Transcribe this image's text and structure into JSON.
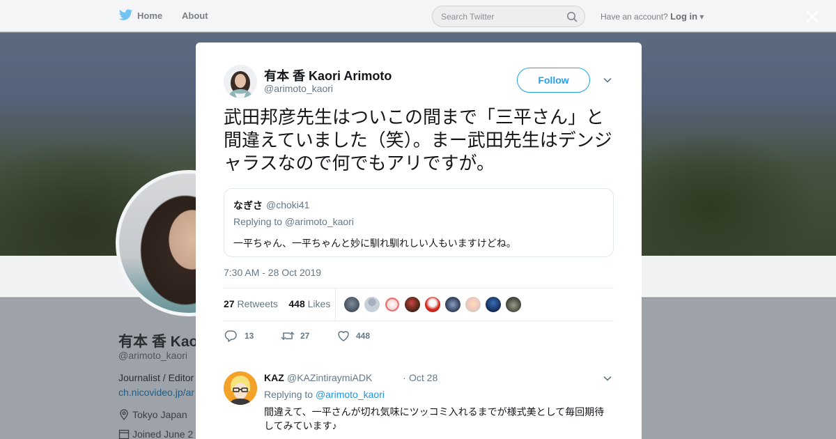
{
  "nav": {
    "home": "Home",
    "about": "About",
    "search_placeholder": "Search Twitter",
    "have_account": "Have an account?",
    "login": "Log in"
  },
  "profile": {
    "name": "有本 香 Kao",
    "handle": "@arimoto_kaori",
    "bio": "Journalist / Editor",
    "link": "ch.nicovideo.jp/ar",
    "location": "Tokyo Japan",
    "joined": "Joined June 2"
  },
  "tweet": {
    "author_name": "有本 香 Kaori Arimoto",
    "author_handle": "@arimoto_kaori",
    "follow_label": "Follow",
    "text": "武田邦彦先生はついこの間まで「三平さん」と間違えていました（笑）。まー武田先生はデンジャラスなので何でもアリですが。",
    "timestamp": "7:30 AM - 28 Oct 2019",
    "retweets_count": "27",
    "retweets_label": "Retweets",
    "likes_count": "448",
    "likes_label": "Likes",
    "actions": {
      "replies": "13",
      "retweets": "27",
      "likes": "448"
    }
  },
  "quote": {
    "name": "なぎさ",
    "handle": "@choki41",
    "replying_to": "Replying to @arimoto_kaori",
    "text": "一平ちゃん、一平ちゃんと妙に馴れ馴れしい人もいますけどね。"
  },
  "reply": {
    "name": "KAZ",
    "handle": "@KAZintiraymiADK",
    "dot": "·",
    "date": "Oct 28",
    "replying_prefix": "Replying to",
    "replying_handle": "@arimoto_kaori",
    "text": "間違えて、一平さんが切れ気味にツッコミ入れるまでが様式美として毎回期待してみています♪"
  },
  "colors": {
    "accent": "#1da1f2",
    "text_primary": "#14171a",
    "text_secondary": "#657786",
    "border": "#e6ecf0"
  },
  "icons": [
    "twitter-bird-icon",
    "search-icon",
    "close-icon",
    "chevron-down-icon",
    "reply-icon",
    "retweet-icon",
    "heart-icon",
    "location-icon",
    "calendar-icon"
  ]
}
